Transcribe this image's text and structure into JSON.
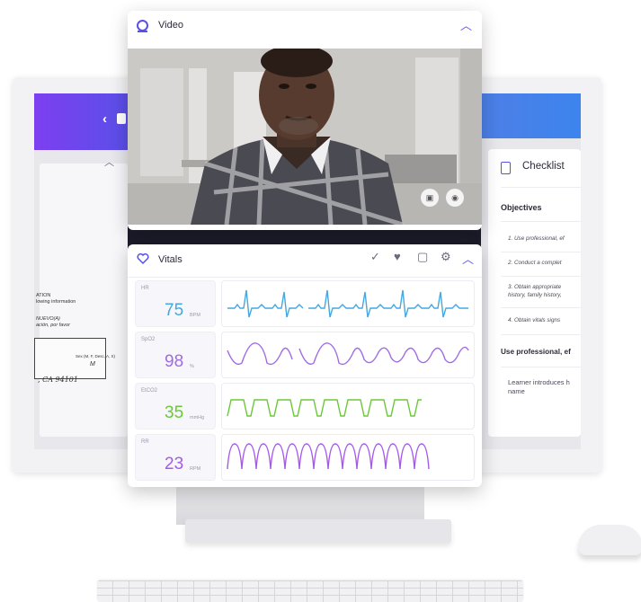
{
  "video_panel": {
    "title": "Video",
    "icon": "webcam-icon",
    "collapse_icon": "chevron-up-icon",
    "controls": [
      "chat-bubble-icon",
      "camera-icon"
    ]
  },
  "vitals_panel": {
    "title": "Vitals",
    "icon": "heart-icon",
    "toolbar_icons": [
      "checkmark-icon",
      "heart-plus-icon",
      "monitor-icon",
      "gear-icon",
      "chevron-up-icon"
    ],
    "vitals": [
      {
        "label": "HR",
        "value": "75",
        "unit": "BPM",
        "color": "#45a8e0"
      },
      {
        "label": "SpO2",
        "value": "98",
        "unit": "%",
        "color": "#a06be6"
      },
      {
        "label": "EtCO2",
        "value": "35",
        "unit": "mmHg",
        "color": "#6bc838"
      },
      {
        "label": "RR",
        "value": "23",
        "unit": "RPM",
        "color": "#a55be8"
      }
    ]
  },
  "checklist_panel": {
    "title": "Checklist",
    "objectives_title": "Objectives",
    "objectives": [
      "1. Use professional, ef",
      "2. Conduct a complet",
      "3. Obtain appropriate",
      "history, family history,",
      "4. Obtain vitals signs"
    ],
    "section_title": "Use professional, ef",
    "section_item_line1": "Learner introduces h",
    "section_item_line2": "name"
  },
  "left_panel": {
    "text_lines": [
      "ATION",
      "lowing information"
    ],
    "italic_lines": [
      "NUEVO(A)",
      "ación, por favor"
    ],
    "form_label": "Sex (M, F, Desc, A, X)",
    "form_value": "M",
    "form_loc": ", CA  94101"
  },
  "colors": {
    "accent": "#5a4fe8",
    "left_bar": "#7d3ff0",
    "right_bar": "#3d84ee"
  }
}
